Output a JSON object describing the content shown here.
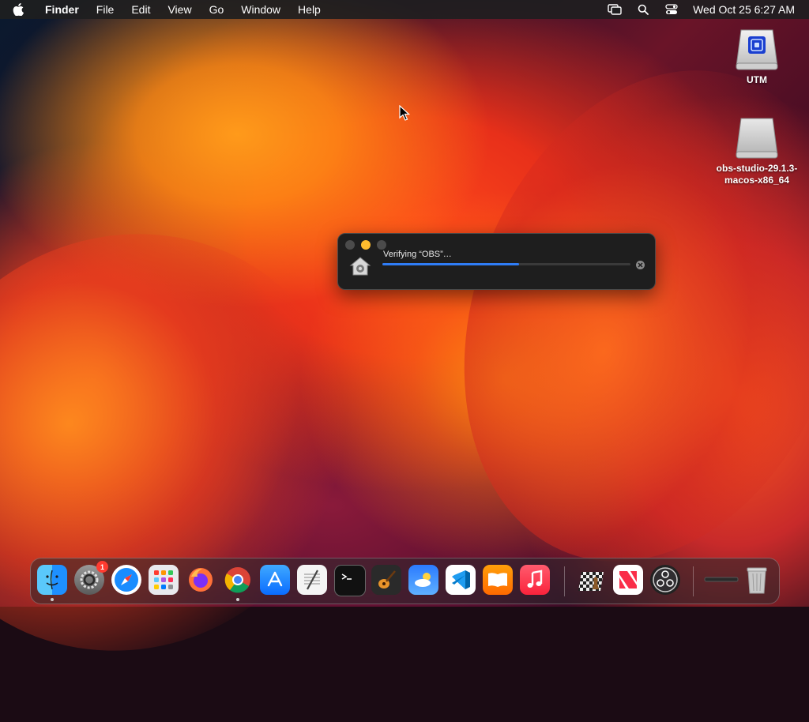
{
  "menubar": {
    "app_name": "Finder",
    "menus": [
      "File",
      "Edit",
      "View",
      "Go",
      "Window",
      "Help"
    ],
    "clock": "Wed Oct 25  6:27 AM",
    "status_icons": [
      "screen-mirroring-icon",
      "search-icon",
      "control-center-icon"
    ]
  },
  "desktop": {
    "icons": [
      {
        "label": "UTM",
        "icon": "disk-image-icon"
      },
      {
        "label": "obs-studio-29.1.3-macos-x86_64",
        "icon": "external-drive-icon"
      }
    ]
  },
  "verify_window": {
    "message": "Verifying “OBS”…",
    "progress": 0.55,
    "icon": "gatekeeper-house-icon",
    "accent_color": "#2f7df6"
  },
  "dock": {
    "apps": [
      {
        "name": "Finder",
        "icon": "finder-icon",
        "running": true
      },
      {
        "name": "System Settings",
        "icon": "gear-icon",
        "badge": "1",
        "running": false
      },
      {
        "name": "Safari",
        "icon": "compass-icon",
        "running": false
      },
      {
        "name": "Launchpad",
        "icon": "grid-icon",
        "running": false
      },
      {
        "name": "Firefox",
        "icon": "firefox-icon",
        "running": false
      },
      {
        "name": "Chrome",
        "icon": "chrome-icon",
        "running": true
      },
      {
        "name": "App Store",
        "icon": "app-store-icon",
        "running": false
      },
      {
        "name": "TextEdit",
        "icon": "textedit-icon",
        "running": false
      },
      {
        "name": "Terminal",
        "icon": "terminal-icon",
        "running": false
      },
      {
        "name": "GarageBand",
        "icon": "guitar-icon",
        "running": false
      },
      {
        "name": "Weather",
        "icon": "weather-icon",
        "running": false
      },
      {
        "name": "VS Code",
        "icon": "vscode-icon",
        "running": false
      },
      {
        "name": "Books",
        "icon": "book-icon",
        "running": false
      },
      {
        "name": "Music",
        "icon": "music-note-icon",
        "running": false
      },
      {
        "name": "Chess",
        "icon": "chess-icon",
        "running": false
      },
      {
        "name": "News",
        "icon": "news-icon",
        "running": false
      },
      {
        "name": "OBS",
        "icon": "obs-icon",
        "running": false
      },
      {
        "name": "Recent Item",
        "icon": "minimized-window-icon",
        "running": false
      },
      {
        "name": "Trash",
        "icon": "trash-icon",
        "running": false
      }
    ]
  }
}
